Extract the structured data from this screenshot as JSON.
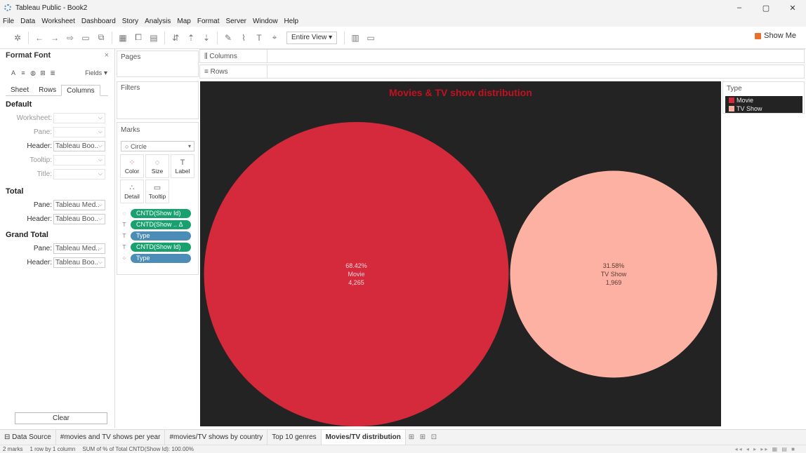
{
  "window": {
    "title": "Tableau Public - Book2",
    "controls": [
      "–",
      "▢",
      "✕"
    ]
  },
  "menu": [
    "File",
    "Data",
    "Worksheet",
    "Dashboard",
    "Story",
    "Analysis",
    "Map",
    "Format",
    "Server",
    "Window",
    "Help"
  ],
  "toolbar": {
    "fit": "Entire View",
    "show_me": "Show Me"
  },
  "format_pane": {
    "title": "Format Font",
    "fields_label": "Fields",
    "tabs": [
      "Sheet",
      "Rows",
      "Columns"
    ],
    "active_tab": "Columns",
    "sections": [
      {
        "title": "Default",
        "rows": [
          {
            "label": "Worksheet:",
            "value": "",
            "disabled": true
          },
          {
            "label": "Pane:",
            "value": "",
            "disabled": true
          },
          {
            "label": "Header:",
            "value": "Tableau Boo..",
            "disabled": false
          },
          {
            "label": "Tooltip:",
            "value": "",
            "disabled": true
          },
          {
            "label": "Title:",
            "value": "",
            "disabled": true
          }
        ]
      },
      {
        "title": "Total",
        "rows": [
          {
            "label": "Pane:",
            "value": "Tableau Med..",
            "disabled": false
          },
          {
            "label": "Header:",
            "value": "Tableau Boo..",
            "disabled": false
          }
        ]
      },
      {
        "title": "Grand Total",
        "rows": [
          {
            "label": "Pane:",
            "value": "Tableau Med..",
            "disabled": false
          },
          {
            "label": "Header:",
            "value": "Tableau Boo..",
            "disabled": false
          }
        ]
      }
    ],
    "clear_label": "Clear"
  },
  "cards": {
    "pages": "Pages",
    "filters": "Filters",
    "marks": "Marks",
    "mark_type": "Circle",
    "mark_buttons": [
      "Color",
      "Size",
      "Label",
      "Detail",
      "Tooltip"
    ],
    "pills": [
      {
        "icon": "size-icon",
        "glyph": "◌",
        "label": "CNTD(Show Id)",
        "kind": "g"
      },
      {
        "icon": "label-icon",
        "glyph": "T",
        "label": "CNTD(Show .. Δ",
        "kind": "g"
      },
      {
        "icon": "label-icon",
        "glyph": "T",
        "label": "Type",
        "kind": "b"
      },
      {
        "icon": "label-icon",
        "glyph": "T",
        "label": "CNTD(Show Id)",
        "kind": "g"
      },
      {
        "icon": "color-icon",
        "glyph": "⁘",
        "label": "Type",
        "kind": "b"
      }
    ]
  },
  "shelves": {
    "columns": "Columns",
    "rows": "Rows"
  },
  "chart_data": {
    "type": "scatter",
    "mark": "circle",
    "title": "Movies & TV show distribution",
    "background": "#232323",
    "points": [
      {
        "type": "Movie",
        "count": 4265,
        "percent": 68.42,
        "pct_label": "68.42%",
        "count_label": "4,265",
        "color": "#d42a3c"
      },
      {
        "type": "TV Show",
        "count": 1969,
        "percent": 31.58,
        "pct_label": "31.58%",
        "count_label": "1,969",
        "color": "#fdb1a2"
      }
    ]
  },
  "legend": {
    "title": "Type",
    "items": [
      {
        "label": "Movie",
        "color": "#d42a3c"
      },
      {
        "label": "TV Show",
        "color": "#fdb1a2"
      }
    ]
  },
  "sheet_tabs": {
    "data_source": "Data Source",
    "tabs": [
      "#movies and TV shows per year",
      "#movies/TV shows by country",
      "Top 10 genres",
      "Movies/TV distribution"
    ],
    "active": "Movies/TV distribution"
  },
  "status": {
    "marks": "2 marks",
    "dims": "1 row by 1 column",
    "sum": "SUM of % of Total CNTD(Show Id): 100.00%"
  }
}
